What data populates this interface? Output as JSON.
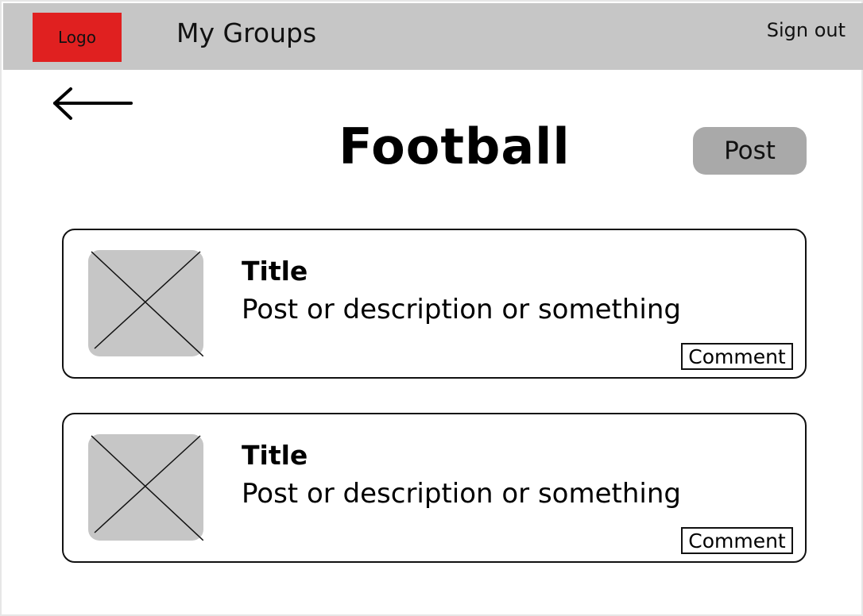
{
  "header": {
    "logo_label": "Logo",
    "nav_title": "My Groups",
    "signout_label": "Sign out"
  },
  "page": {
    "title": "Football",
    "post_button_label": "Post"
  },
  "posts": [
    {
      "title": "Title",
      "description": "Post or description or something",
      "comment_label": "Comment"
    },
    {
      "title": "Title",
      "description": "Post or description or something",
      "comment_label": "Comment"
    }
  ],
  "colors": {
    "header_bg": "#c6c6c6",
    "logo_bg": "#e02020",
    "post_button_bg": "#a9a9a9",
    "image_placeholder": "#c6c6c6"
  },
  "icons": {
    "back": "back-arrow-icon",
    "image_placeholder": "image-placeholder-icon"
  }
}
